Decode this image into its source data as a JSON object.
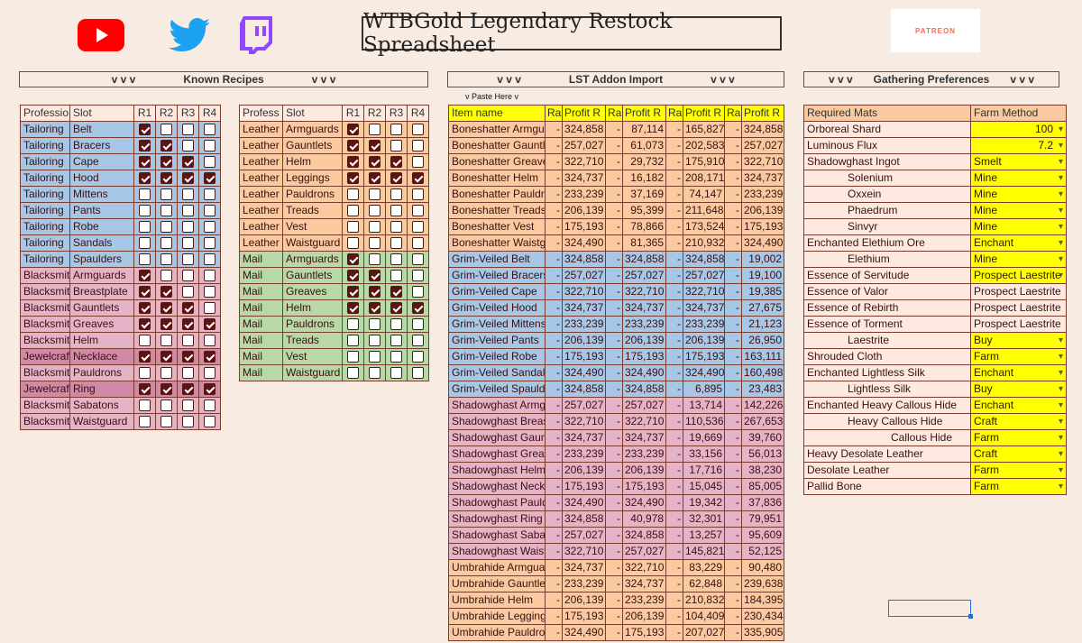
{
  "header": {
    "title": "WTBGold Legendary Restock Spreadsheet",
    "icons": [
      "youtube-icon",
      "twitter-icon",
      "twitch-icon"
    ],
    "patreon_label": "PATREON"
  },
  "colors": {
    "tailoring": "#a7c7e7",
    "blacksmithing": "#e5b3c8",
    "jewelcrafting": "#d08aa7",
    "leather": "#f9c9a0",
    "mail": "#b8d8a8",
    "yellow": "#ffff00",
    "bg": "#f8ece2"
  },
  "sections": {
    "known_recipes": {
      "arrows_left": "v v v",
      "label": "Known Recipes",
      "arrows_right": "v v v"
    },
    "lst_import": {
      "arrows_left": "v v v",
      "label": "LST Addon Import",
      "arrows_right": "v v v",
      "paste": "v  Paste Here  v"
    },
    "gathering": {
      "arrows_left": "v v v",
      "label": "Gathering Preferences",
      "arrows_right": "v v v"
    }
  },
  "recipes_left": {
    "headers": [
      "Professio",
      "Slot",
      "R1",
      "R2",
      "R3",
      "R4"
    ],
    "rows": [
      {
        "prof": "Tailoring",
        "slot": "Belt",
        "k": "tailoring",
        "r": [
          1,
          0,
          0,
          0
        ]
      },
      {
        "prof": "Tailoring",
        "slot": "Bracers",
        "k": "tailoring",
        "r": [
          1,
          1,
          0,
          0
        ]
      },
      {
        "prof": "Tailoring",
        "slot": "Cape",
        "k": "tailoring",
        "r": [
          1,
          1,
          1,
          0
        ]
      },
      {
        "prof": "Tailoring",
        "slot": "Hood",
        "k": "tailoring",
        "r": [
          1,
          1,
          1,
          1
        ]
      },
      {
        "prof": "Tailoring",
        "slot": "Mittens",
        "k": "tailoring",
        "r": [
          0,
          0,
          0,
          0
        ]
      },
      {
        "prof": "Tailoring",
        "slot": "Pants",
        "k": "tailoring",
        "r": [
          0,
          0,
          0,
          0
        ]
      },
      {
        "prof": "Tailoring",
        "slot": "Robe",
        "k": "tailoring",
        "r": [
          0,
          0,
          0,
          0
        ]
      },
      {
        "prof": "Tailoring",
        "slot": "Sandals",
        "k": "tailoring",
        "r": [
          0,
          0,
          0,
          0
        ]
      },
      {
        "prof": "Tailoring",
        "slot": "Spaulders",
        "k": "tailoring",
        "r": [
          0,
          0,
          0,
          0
        ]
      },
      {
        "prof": "Blacksmit",
        "slot": "Armguards",
        "k": "blacksmithing",
        "r": [
          1,
          0,
          0,
          0
        ]
      },
      {
        "prof": "Blacksmit",
        "slot": "Breastplate",
        "k": "blacksmithing",
        "r": [
          1,
          1,
          0,
          0
        ]
      },
      {
        "prof": "Blacksmit",
        "slot": "Gauntlets",
        "k": "blacksmithing",
        "r": [
          1,
          1,
          1,
          0
        ]
      },
      {
        "prof": "Blacksmit",
        "slot": "Greaves",
        "k": "blacksmithing",
        "r": [
          1,
          1,
          1,
          1
        ]
      },
      {
        "prof": "Blacksmit",
        "slot": "Helm",
        "k": "blacksmithing",
        "r": [
          0,
          0,
          0,
          0
        ]
      },
      {
        "prof": "Jewelcraft",
        "slot": "Necklace",
        "k": "jewelcrafting",
        "r": [
          1,
          1,
          1,
          1
        ]
      },
      {
        "prof": "Blacksmit",
        "slot": "Pauldrons",
        "k": "blacksmithing",
        "r": [
          0,
          0,
          0,
          0
        ]
      },
      {
        "prof": "Jewelcraft",
        "slot": "Ring",
        "k": "jewelcrafting",
        "r": [
          1,
          1,
          1,
          1
        ]
      },
      {
        "prof": "Blacksmit",
        "slot": "Sabatons",
        "k": "blacksmithing",
        "r": [
          0,
          0,
          0,
          0
        ]
      },
      {
        "prof": "Blacksmit",
        "slot": "Waistguard",
        "k": "blacksmithing",
        "r": [
          0,
          0,
          0,
          0
        ]
      }
    ]
  },
  "recipes_mid": {
    "headers": [
      "Profess",
      "Slot",
      "R1",
      "R2",
      "R3",
      "R4"
    ],
    "rows": [
      {
        "prof": "Leather",
        "slot": "Armguards",
        "k": "leather",
        "r": [
          1,
          0,
          0,
          0
        ]
      },
      {
        "prof": "Leather",
        "slot": "Gauntlets",
        "k": "leather",
        "r": [
          1,
          1,
          0,
          0
        ]
      },
      {
        "prof": "Leather",
        "slot": "Helm",
        "k": "leather",
        "r": [
          1,
          1,
          1,
          0
        ]
      },
      {
        "prof": "Leather",
        "slot": "Leggings",
        "k": "leather",
        "r": [
          1,
          1,
          1,
          1
        ]
      },
      {
        "prof": "Leather",
        "slot": "Pauldrons",
        "k": "leather",
        "r": [
          0,
          0,
          0,
          0
        ]
      },
      {
        "prof": "Leather",
        "slot": "Treads",
        "k": "leather",
        "r": [
          0,
          0,
          0,
          0
        ]
      },
      {
        "prof": "Leather",
        "slot": "Vest",
        "k": "leather",
        "r": [
          0,
          0,
          0,
          0
        ]
      },
      {
        "prof": "Leather",
        "slot": "Waistguard",
        "k": "leather",
        "r": [
          0,
          0,
          0,
          0
        ]
      },
      {
        "prof": "Mail",
        "slot": "Armguards",
        "k": "mail",
        "r": [
          1,
          0,
          0,
          0
        ]
      },
      {
        "prof": "Mail",
        "slot": "Gauntlets",
        "k": "mail",
        "r": [
          1,
          1,
          0,
          0
        ]
      },
      {
        "prof": "Mail",
        "slot": "Greaves",
        "k": "mail",
        "r": [
          1,
          1,
          1,
          0
        ]
      },
      {
        "prof": "Mail",
        "slot": "Helm",
        "k": "mail",
        "r": [
          1,
          1,
          1,
          1
        ]
      },
      {
        "prof": "Mail",
        "slot": "Pauldrons",
        "k": "mail",
        "r": [
          0,
          0,
          0,
          0
        ]
      },
      {
        "prof": "Mail",
        "slot": "Treads",
        "k": "mail",
        "r": [
          0,
          0,
          0,
          0
        ]
      },
      {
        "prof": "Mail",
        "slot": "Vest",
        "k": "mail",
        "r": [
          0,
          0,
          0,
          0
        ]
      },
      {
        "prof": "Mail",
        "slot": "Waistguard",
        "k": "mail",
        "r": [
          0,
          0,
          0,
          0
        ]
      }
    ]
  },
  "lst": {
    "headers": [
      "Item name",
      "Ran",
      "Profit R",
      "Ran",
      "Profit R",
      "Ran",
      "Profit R",
      "Ran",
      "Profit R"
    ],
    "rows": [
      {
        "name": "Boneshatter Armguards",
        "k": "leather",
        "v": [
          "-",
          "324,858",
          "-",
          "87,114",
          "-",
          "165,827",
          "-",
          "324,858"
        ]
      },
      {
        "name": "Boneshatter Gauntlets",
        "k": "leather",
        "v": [
          "-",
          "257,027",
          "-",
          "61,073",
          "-",
          "202,583",
          "-",
          "257,027"
        ]
      },
      {
        "name": "Boneshatter Greaves",
        "k": "leather",
        "v": [
          "-",
          "322,710",
          "-",
          "29,732",
          "-",
          "175,910",
          "-",
          "322,710"
        ]
      },
      {
        "name": "Boneshatter Helm",
        "k": "leather",
        "v": [
          "-",
          "324,737",
          "-",
          "16,182",
          "-",
          "208,171",
          "-",
          "324,737"
        ]
      },
      {
        "name": "Boneshatter Pauldrons",
        "k": "leather",
        "v": [
          "-",
          "233,239",
          "-",
          "37,169",
          "-",
          "74,147",
          "-",
          "233,239"
        ]
      },
      {
        "name": "Boneshatter Treads",
        "k": "leather",
        "v": [
          "-",
          "206,139",
          "-",
          "95,399",
          "-",
          "211,648",
          "-",
          "206,139"
        ]
      },
      {
        "name": "Boneshatter Vest",
        "k": "leather",
        "v": [
          "-",
          "175,193",
          "-",
          "78,866",
          "-",
          "173,524",
          "-",
          "175,193"
        ]
      },
      {
        "name": "Boneshatter Waistguard",
        "k": "leather",
        "v": [
          "-",
          "324,490",
          "-",
          "81,365",
          "-",
          "210,932",
          "-",
          "324,490"
        ]
      },
      {
        "name": "Grim-Veiled Belt",
        "k": "tailoring",
        "v": [
          "-",
          "324,858",
          "-",
          "324,858",
          "-",
          "324,858",
          "-",
          "19,002"
        ]
      },
      {
        "name": "Grim-Veiled Bracers",
        "k": "tailoring",
        "v": [
          "-",
          "257,027",
          "-",
          "257,027",
          "-",
          "257,027",
          "-",
          "19,100"
        ]
      },
      {
        "name": "Grim-Veiled Cape",
        "k": "tailoring",
        "v": [
          "-",
          "322,710",
          "-",
          "322,710",
          "-",
          "322,710",
          "-",
          "19,385"
        ]
      },
      {
        "name": "Grim-Veiled Hood",
        "k": "tailoring",
        "v": [
          "-",
          "324,737",
          "-",
          "324,737",
          "-",
          "324,737",
          "-",
          "27,675"
        ]
      },
      {
        "name": "Grim-Veiled Mittens",
        "k": "tailoring",
        "v": [
          "-",
          "233,239",
          "-",
          "233,239",
          "-",
          "233,239",
          "-",
          "21,123"
        ]
      },
      {
        "name": "Grim-Veiled Pants",
        "k": "tailoring",
        "v": [
          "-",
          "206,139",
          "-",
          "206,139",
          "-",
          "206,139",
          "-",
          "26,950"
        ]
      },
      {
        "name": "Grim-Veiled Robe",
        "k": "tailoring",
        "v": [
          "-",
          "175,193",
          "-",
          "175,193",
          "-",
          "175,193",
          "-",
          "163,111"
        ]
      },
      {
        "name": "Grim-Veiled Sandals",
        "k": "tailoring",
        "v": [
          "-",
          "324,490",
          "-",
          "324,490",
          "-",
          "324,490",
          "-",
          "160,498"
        ]
      },
      {
        "name": "Grim-Veiled Spaulders",
        "k": "tailoring",
        "v": [
          "-",
          "324,858",
          "-",
          "324,858",
          "-",
          "6,895",
          "-",
          "23,483"
        ]
      },
      {
        "name": "Shadowghast Armguards",
        "k": "blacksmithing",
        "v": [
          "-",
          "257,027",
          "-",
          "257,027",
          "-",
          "13,714",
          "-",
          "142,226"
        ]
      },
      {
        "name": "Shadowghast Breastplate",
        "k": "blacksmithing",
        "v": [
          "-",
          "322,710",
          "-",
          "322,710",
          "-",
          "110,536",
          "-",
          "267,653"
        ]
      },
      {
        "name": "Shadowghast Gauntlets",
        "k": "blacksmithing",
        "v": [
          "-",
          "324,737",
          "-",
          "324,737",
          "-",
          "19,669",
          "-",
          "39,760"
        ]
      },
      {
        "name": "Shadowghast Greaves",
        "k": "blacksmithing",
        "v": [
          "-",
          "233,239",
          "-",
          "233,239",
          "-",
          "33,156",
          "-",
          "56,013"
        ]
      },
      {
        "name": "Shadowghast Helm",
        "k": "blacksmithing",
        "v": [
          "-",
          "206,139",
          "-",
          "206,139",
          "-",
          "17,716",
          "-",
          "38,230"
        ]
      },
      {
        "name": "Shadowghast Necklace",
        "k": "blacksmithing",
        "v": [
          "-",
          "175,193",
          "-",
          "175,193",
          "-",
          "15,045",
          "-",
          "85,005"
        ]
      },
      {
        "name": "Shadowghast Pauldrons",
        "k": "blacksmithing",
        "v": [
          "-",
          "324,490",
          "-",
          "324,490",
          "-",
          "19,342",
          "-",
          "37,836"
        ]
      },
      {
        "name": "Shadowghast Ring",
        "k": "blacksmithing",
        "v": [
          "-",
          "324,858",
          "-",
          "40,978",
          "-",
          "32,301",
          "-",
          "79,951"
        ]
      },
      {
        "name": "Shadowghast Sabatons",
        "k": "blacksmithing",
        "v": [
          "-",
          "257,027",
          "-",
          "324,858",
          "-",
          "13,257",
          "-",
          "95,609"
        ]
      },
      {
        "name": "Shadowghast Waistguard",
        "k": "blacksmithing",
        "v": [
          "-",
          "322,710",
          "-",
          "257,027",
          "-",
          "145,821",
          "-",
          "52,125"
        ]
      },
      {
        "name": "Umbrahide Armguards",
        "k": "leather",
        "v": [
          "-",
          "324,737",
          "-",
          "322,710",
          "-",
          "83,229",
          "-",
          "90,480"
        ]
      },
      {
        "name": "Umbrahide Gauntlets",
        "k": "leather",
        "v": [
          "-",
          "233,239",
          "-",
          "324,737",
          "-",
          "62,848",
          "-",
          "239,638"
        ]
      },
      {
        "name": "Umbrahide Helm",
        "k": "leather",
        "v": [
          "-",
          "206,139",
          "-",
          "233,239",
          "-",
          "210,832",
          "-",
          "184,395"
        ]
      },
      {
        "name": "Umbrahide Leggings",
        "k": "leather",
        "v": [
          "-",
          "175,193",
          "-",
          "206,139",
          "-",
          "104,409",
          "-",
          "230,434"
        ]
      },
      {
        "name": "Umbrahide Pauldrons",
        "k": "leather",
        "v": [
          "-",
          "324,490",
          "-",
          "175,193",
          "-",
          "207,027",
          "-",
          "335,905"
        ]
      }
    ]
  },
  "gathering": {
    "headers": [
      "Required Mats",
      "Farm Method"
    ],
    "rows": [
      {
        "mat": "Orboreal Shard",
        "method": "100",
        "indent": 0,
        "yellow": true,
        "dd": true,
        "num": true
      },
      {
        "mat": "Luminous Flux",
        "method": "7.2",
        "indent": 0,
        "yellow": true,
        "dd": true,
        "num": true
      },
      {
        "mat": "Shadowghast Ingot",
        "method": "Smelt",
        "indent": 0,
        "yellow": true,
        "dd": true
      },
      {
        "mat": "Solenium",
        "method": "Mine",
        "indent": 1,
        "yellow": true,
        "dd": true
      },
      {
        "mat": "Oxxein",
        "method": "Mine",
        "indent": 1,
        "yellow": true,
        "dd": true
      },
      {
        "mat": "Phaedrum",
        "method": "Mine",
        "indent": 1,
        "yellow": true,
        "dd": true
      },
      {
        "mat": "Sinvyr",
        "method": "Mine",
        "indent": 1,
        "yellow": true,
        "dd": true
      },
      {
        "mat": "Enchanted Elethium Ore",
        "method": "Enchant",
        "indent": 0,
        "yellow": true,
        "dd": true
      },
      {
        "mat": "Elethium",
        "method": "Mine",
        "indent": 1,
        "yellow": true,
        "dd": true
      },
      {
        "mat": "Essence of Servitude",
        "method": "Prospect Laestrite",
        "indent": 0,
        "yellow": true,
        "dd": true
      },
      {
        "mat": "Essence of Valor",
        "method": "Prospect Laestrite",
        "indent": 0,
        "yellow": false,
        "dd": false
      },
      {
        "mat": "Essence of Rebirth",
        "method": "Prospect Laestrite",
        "indent": 0,
        "yellow": false,
        "dd": false
      },
      {
        "mat": "Essence of Torment",
        "method": "Prospect Laestrite",
        "indent": 0,
        "yellow": false,
        "dd": false
      },
      {
        "mat": "Laestrite",
        "method": "Buy",
        "indent": 1,
        "yellow": true,
        "dd": true
      },
      {
        "mat": "Shrouded Cloth",
        "method": "Farm",
        "indent": 0,
        "yellow": true,
        "dd": true
      },
      {
        "mat": "Enchanted Lightless Silk",
        "method": "Enchant",
        "indent": 0,
        "yellow": true,
        "dd": true
      },
      {
        "mat": "Lightless Silk",
        "method": "Buy",
        "indent": 1,
        "yellow": true,
        "dd": true
      },
      {
        "mat": "Enchanted Heavy Callous Hide",
        "method": "Enchant",
        "indent": 0,
        "yellow": true,
        "dd": true
      },
      {
        "mat": "Heavy Callous Hide",
        "method": "Craft",
        "indent": 1,
        "yellow": true,
        "dd": true
      },
      {
        "mat": "Callous Hide",
        "method": "Farm",
        "indent": 2,
        "yellow": true,
        "dd": true
      },
      {
        "mat": "Heavy Desolate Leather",
        "method": "Craft",
        "indent": 0,
        "yellow": true,
        "dd": true
      },
      {
        "mat": "Desolate Leather",
        "method": "Farm",
        "indent": 0,
        "yellow": true,
        "dd": true
      },
      {
        "mat": "Pallid Bone",
        "method": "Farm",
        "indent": 0,
        "yellow": true,
        "dd": true
      }
    ]
  }
}
